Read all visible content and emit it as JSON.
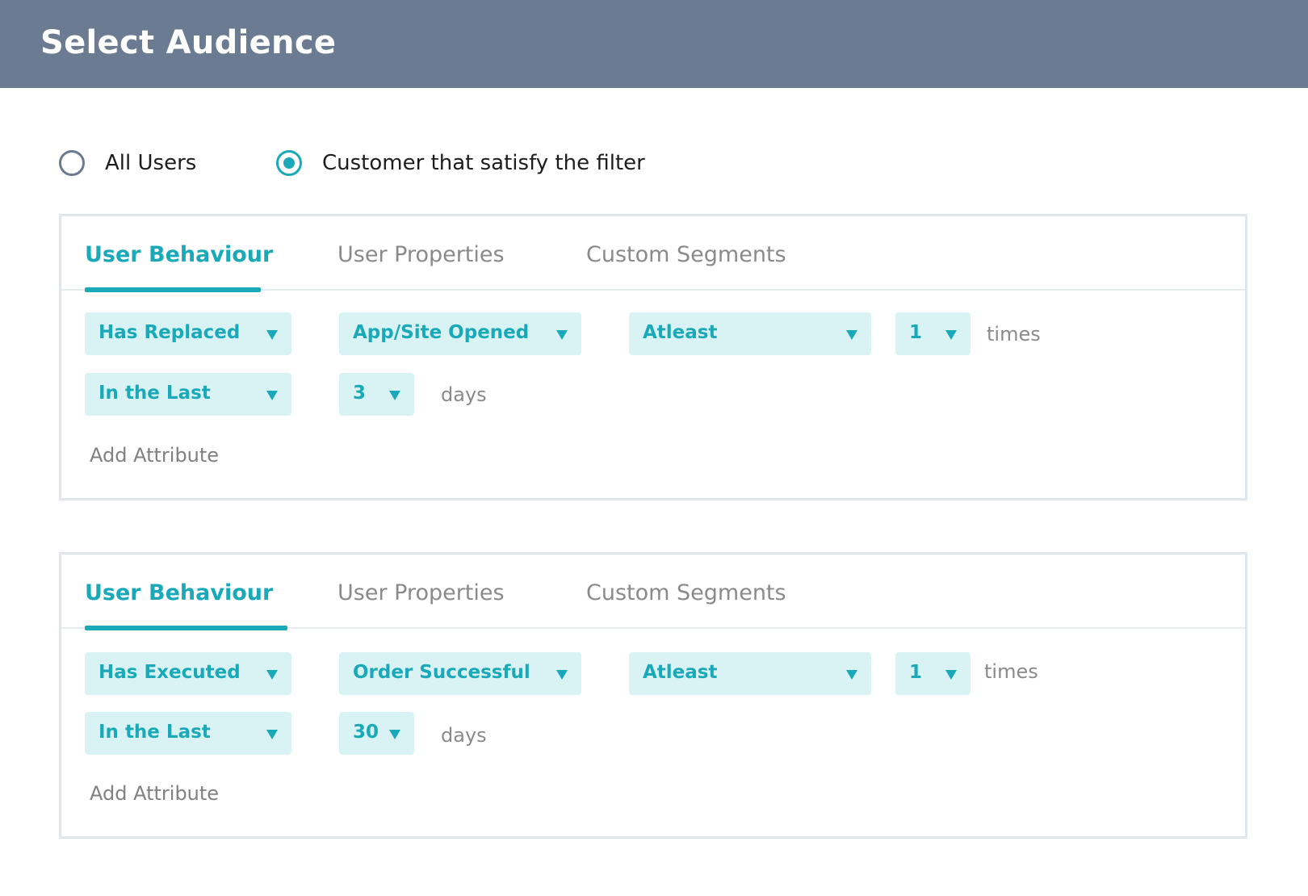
{
  "header": {
    "title": "Select Audience"
  },
  "audience": {
    "options": [
      {
        "label": "All Users",
        "selected": false
      },
      {
        "label": "Customer that satisfy the filter",
        "selected": true
      }
    ]
  },
  "colors": {
    "header_bg": "#6b7b92",
    "accent": "#1aa9b8",
    "dropdown_bg": "#d9f3f4",
    "border": "#e1e5ec"
  },
  "filters": [
    {
      "tabs": [
        "User Behaviour",
        "User Properties",
        "Custom Segments"
      ],
      "active_tab": "User Behaviour",
      "action": "Has Replaced",
      "event": "App/Site Opened",
      "frequency": "Atleast",
      "count": "1",
      "count_unit": "times",
      "timeframe": "In the Last",
      "duration": "3",
      "duration_unit": "days",
      "add_attribute_label": "Add Attribute"
    },
    {
      "tabs": [
        "User Behaviour",
        "User Properties",
        "Custom Segments"
      ],
      "active_tab": "User Behaviour",
      "action": "Has Executed",
      "event": "Order Successful",
      "frequency": "Atleast",
      "count": "1",
      "count_unit": "times",
      "timeframe": "In the Last",
      "duration": "30",
      "duration_unit": "days",
      "add_attribute_label": "Add Attribute"
    }
  ]
}
